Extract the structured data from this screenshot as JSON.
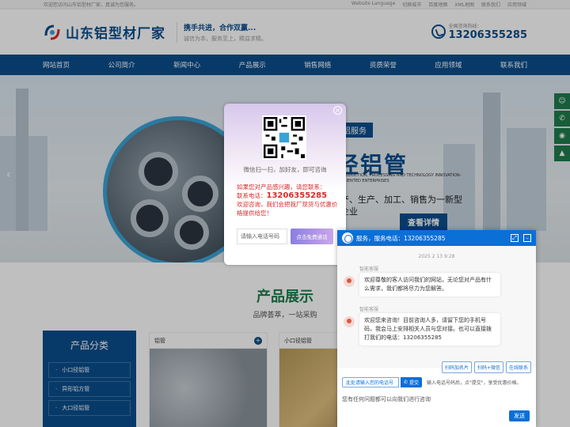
{
  "topbar": {
    "welcome": "欢迎您访问山东铝型材厂家，真诚为您服务。",
    "links": [
      "Website Language",
      "切换城市",
      "百度地图",
      "XML地图",
      "联系我们",
      "应用领域"
    ]
  },
  "header": {
    "logo_text": "山东铝型材厂家",
    "slogan1": "携手共进，合作双赢...",
    "slogan2": "诚信为本，服务至上，精益求精。",
    "hotline_label": "全国咨询热线：",
    "hotline": "13206355285"
  },
  "nav": [
    "网站首页",
    "公司简介",
    "新闻中心",
    "产品展示",
    "销售网络",
    "资质荣誉",
    "应用领域",
    "联系我们"
  ],
  "banner": {
    "tag": "铝服务",
    "title": "径铝管",
    "en": "PRODUCTION, PROCESSING AND TECHNOLOGY INNOVATION-ORIENTED ENTERPRISES",
    "desc": "产、生产、加工、销售为一新型企业",
    "button": "查看详情"
  },
  "side_icons": [
    "person-icon",
    "phone-icon",
    "wechat-icon",
    "top-icon"
  ],
  "products": {
    "title": "产品展示",
    "subtitle": "品牌荟萃，一站采购",
    "category_title": "产品分类",
    "categories": [
      "小口径铝管",
      "异形铝方管",
      "大口径铝管"
    ],
    "cards": [
      "铝管",
      "小口径铝管"
    ]
  },
  "popup": {
    "qr_caption": "微信扫一扫，加好友，即可咨询",
    "line1": "如果您对产品感兴趣，请您联系：",
    "tel_label": "联系电话：",
    "tel": "13206355285",
    "line2": "欢迎咨询，我们会把我厂现货与优惠价格提供给您！",
    "input_placeholder": "请输入电话号码",
    "button": "点击免费通话"
  },
  "chat": {
    "header": "服务，服务电话：13206355285",
    "timestamp": "2025 2 13 9:28",
    "agent_name": "智能客服",
    "msg1": "欢迎尊敬的客人访问我们的网站，无论您对产品有什么需求，我们都将尽力为您解答。",
    "msg2_prefix": "欢迎您来咨询！目前咨询人多，请留下您的手机号码，我会马上安排相关人员与您对接。也可以直接拨打我们的电话：",
    "msg2_tel": "13206355285",
    "quick_buttons": [
      "扫码加名片",
      "扫码+微信",
      "在线联系"
    ],
    "phone_placeholder": "此处请输入您的电话号",
    "submit": "提交",
    "submit_hint": "输入电话号码后，点\"提交\"，享受优惠价格。",
    "message_placeholder": "您有任何问题都可以向我们进行咨询",
    "send": "发送"
  },
  "colors": {
    "brand_blue": "#0b4e8c",
    "chat_blue": "#0b6fd8",
    "green": "#1f7d4d",
    "red": "#d92a2a"
  }
}
